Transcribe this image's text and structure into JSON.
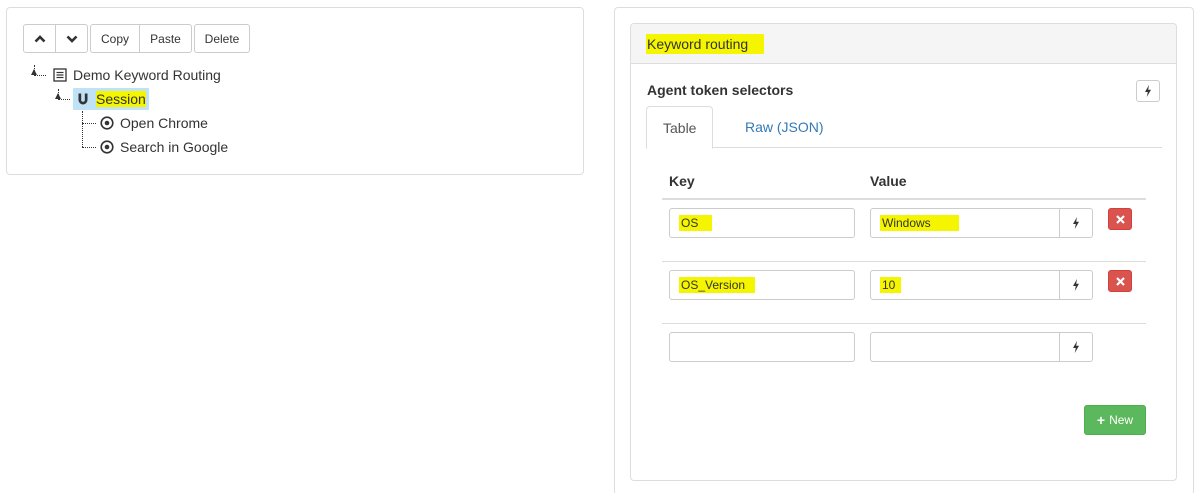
{
  "toolbar": {
    "up_icon": "chevron-up-icon",
    "down_icon": "chevron-down-icon",
    "copy_label": "Copy",
    "paste_label": "Paste",
    "delete_label": "Delete"
  },
  "tree": {
    "root": {
      "label": "Demo Keyword Routing",
      "icon": "list-document-icon"
    },
    "session": {
      "label": "Session",
      "icon": "magnet-icon",
      "selected": true
    },
    "children": [
      {
        "label": "Open Chrome",
        "icon": "target-dot-icon"
      },
      {
        "label": "Search in Google",
        "icon": "target-dot-icon"
      }
    ]
  },
  "panel": {
    "header": "Keyword routing",
    "section_title": "Agent token selectors",
    "tabs": [
      {
        "label": "Table",
        "active": true
      },
      {
        "label": "Raw (JSON)",
        "active": false
      }
    ],
    "columns": {
      "key": "Key",
      "value": "Value"
    },
    "rows": [
      {
        "key": "OS",
        "value": "Windows"
      },
      {
        "key": "OS_Version",
        "value": "10"
      },
      {
        "key": "",
        "value": ""
      }
    ],
    "new_label": "New"
  },
  "colors": {
    "highlight": "#f5f500",
    "selected_bg": "#bfe2f7",
    "link": "#337ab7",
    "danger": "#d9534f",
    "success": "#5cb85c"
  }
}
